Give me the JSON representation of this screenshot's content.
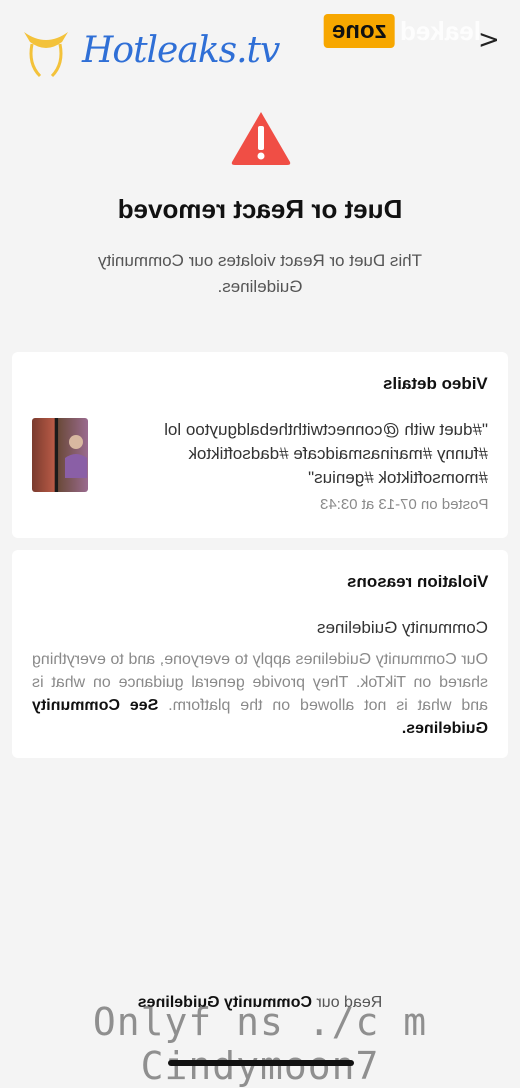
{
  "header": {
    "close_label": "<",
    "watermark_leaked": "leaked",
    "watermark_zone": "zone",
    "brand_text": "Hotleaks.tv"
  },
  "alert": {
    "icon": "warning-triangle-icon",
    "title": "Duet or React removed",
    "subtitle": "This Duet or React violates our Community Guidelines."
  },
  "video_card": {
    "title": "Video details",
    "description": "\"#duet with @connectwiththebaldguytoo lol #funny #marinasmaidcafe #dadsoftiktok #momsoftiktok #genius\"",
    "posted": "Posted on 07-13 at 03:43"
  },
  "violation_card": {
    "title": "Violation reasons",
    "subtitle": "Community Guidelines",
    "body": "Our Community Guidelines apply to everyone, and to everything shared on TikTok. They provide general guidance on what is and what is not allowed on the platform. ",
    "link": "See Community Guidelines."
  },
  "footer": {
    "read_prefix": "Read our ",
    "read_link": "Community Guidelines",
    "watermark": "Onlyf ns ./c m Cindymoon7"
  },
  "colors": {
    "accent_warning": "#f04e45",
    "brand": "#2f6fd6",
    "watermark_zone": "#f7a700"
  }
}
